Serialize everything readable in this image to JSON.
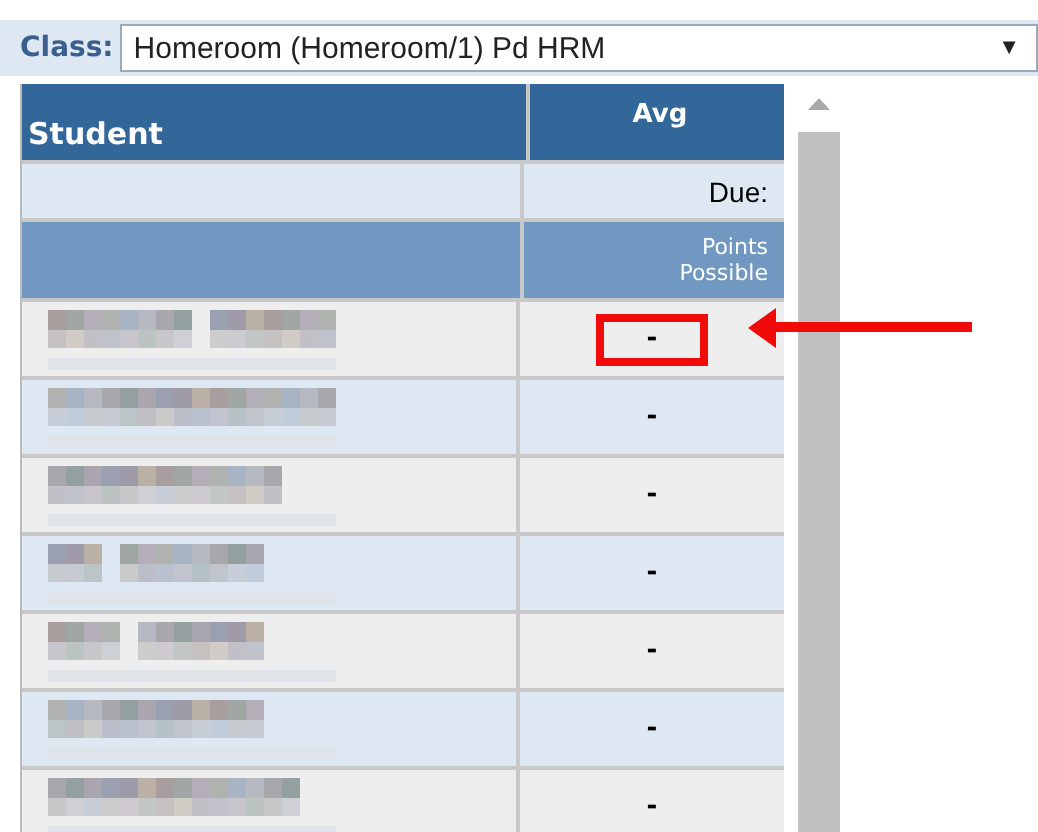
{
  "class_selector": {
    "label": "Class:",
    "value": "Homeroom (Homeroom/1) Pd HRM",
    "caret": "▼"
  },
  "table": {
    "columns": [
      "Student",
      "Avg"
    ],
    "due_label": "Due:",
    "points_label": "Points Possible",
    "rows": [
      {
        "avg": "-",
        "highlighted": true
      },
      {
        "avg": "-",
        "highlighted": false
      },
      {
        "avg": "-",
        "highlighted": false
      },
      {
        "avg": "-",
        "highlighted": false
      },
      {
        "avg": "-",
        "highlighted": false
      },
      {
        "avg": "-",
        "highlighted": false
      },
      {
        "avg": "-",
        "highlighted": false
      }
    ]
  }
}
